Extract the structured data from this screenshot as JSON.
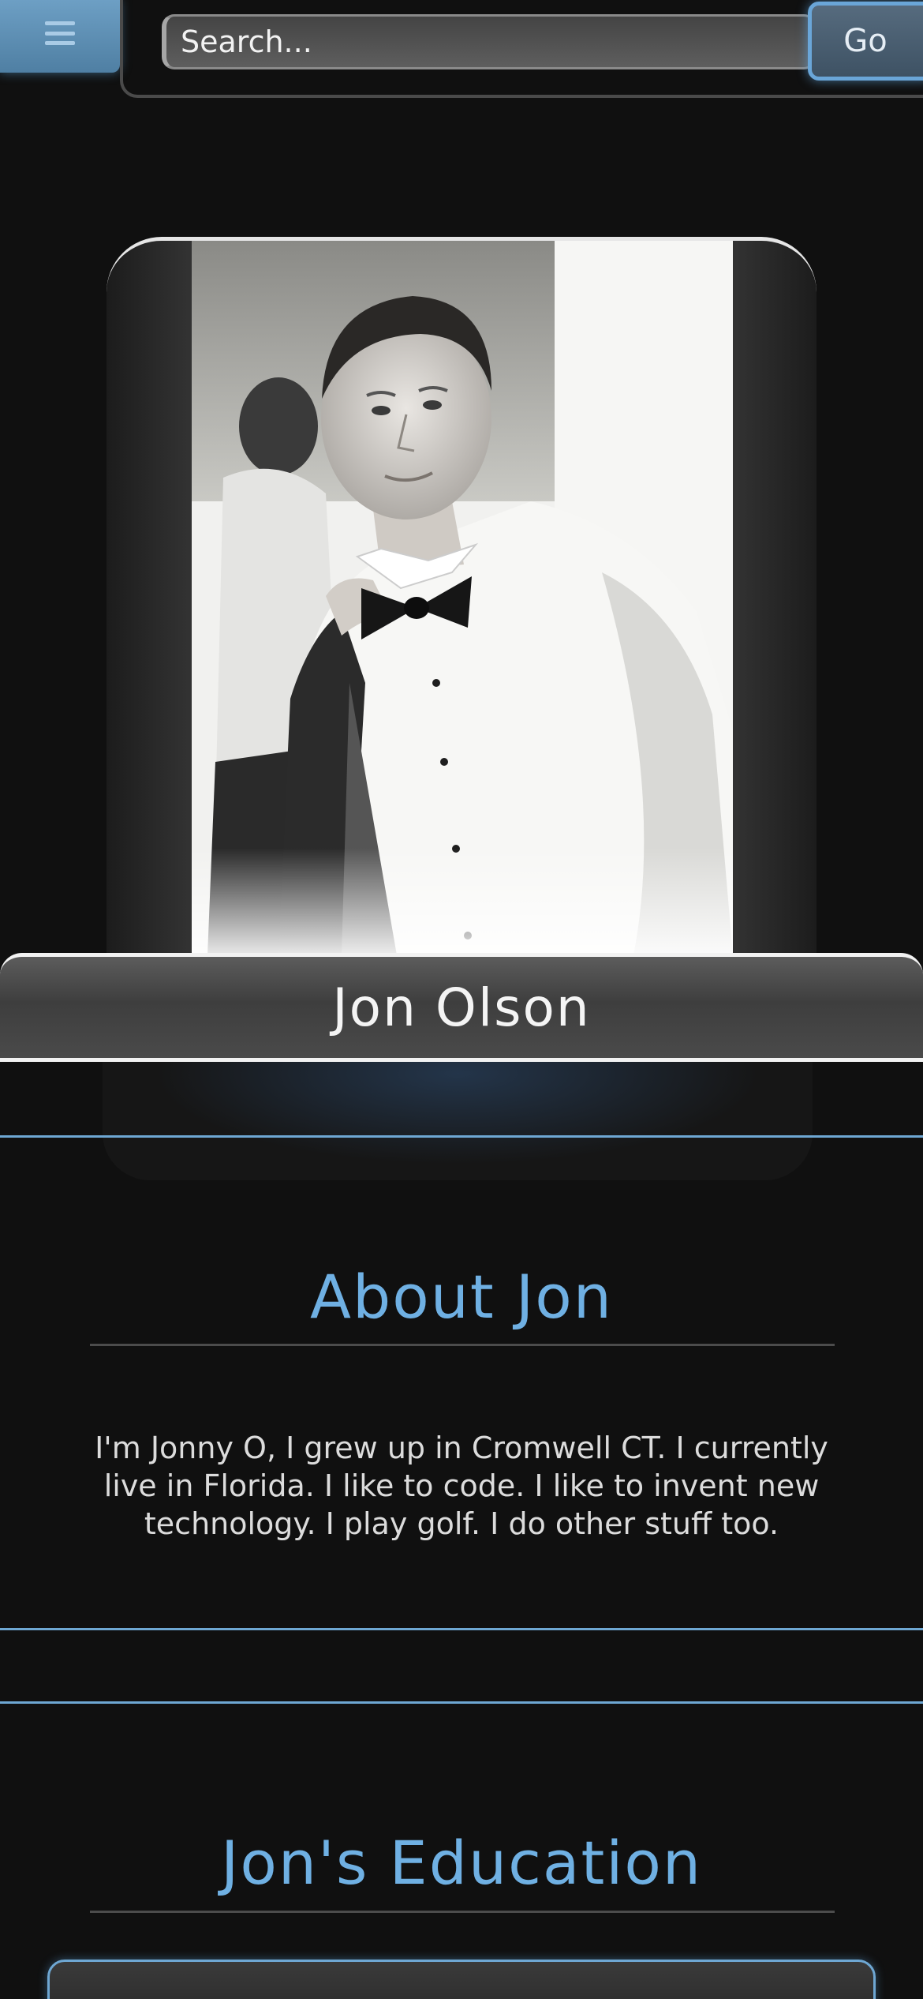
{
  "header": {
    "menu_icon": "hamburger-icon",
    "search_placeholder": "Search...",
    "go_label": "Go"
  },
  "profile": {
    "name": "Jon Olson",
    "photo_desc_icon": "profile-photo"
  },
  "about": {
    "title": "About Jon",
    "text": "I'm Jonny O, I grew up in Cromwell CT. I currently live in Florida. I like to code. I like to invent new technology. I play golf. I do other stuff too."
  },
  "education": {
    "title": "Jon's Education"
  },
  "colors": {
    "background": "#101010",
    "accent": "#6fb0e3",
    "rule": "#6ea7d3"
  }
}
